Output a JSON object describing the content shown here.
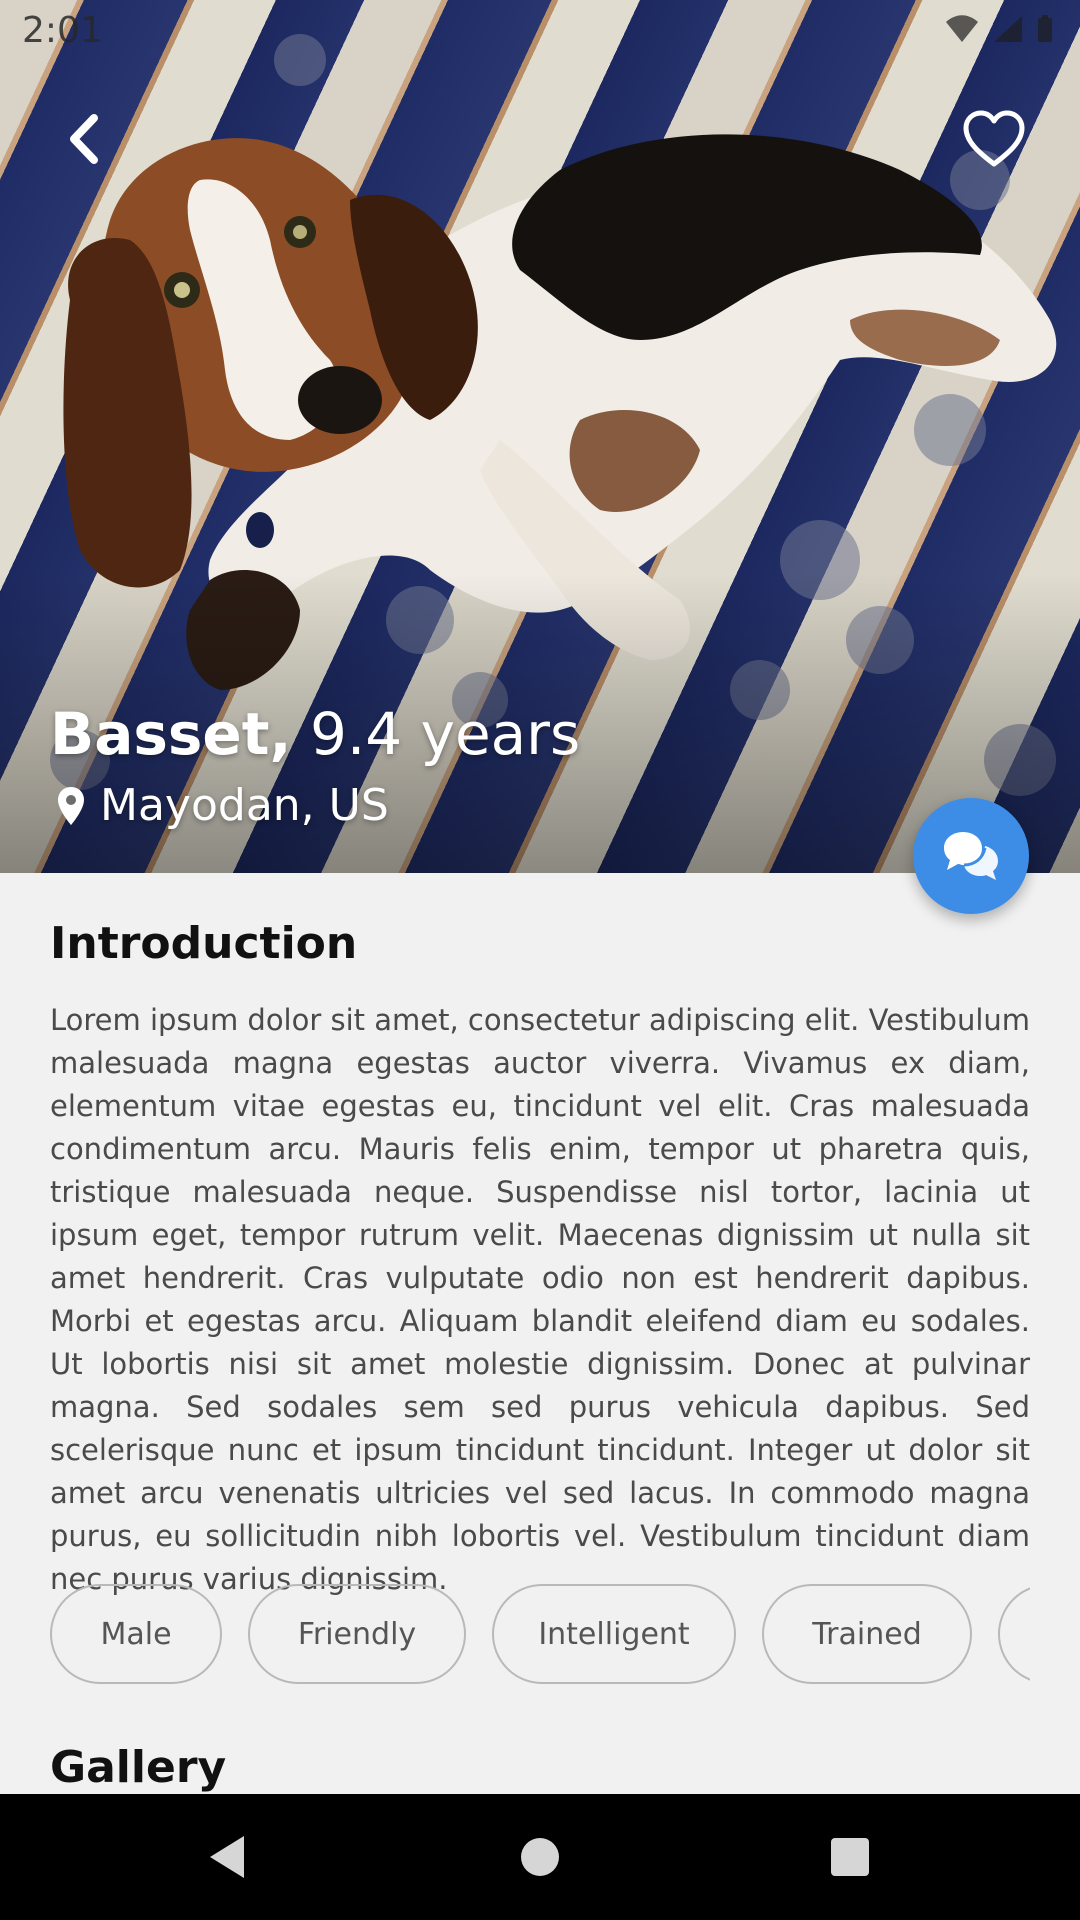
{
  "status_bar": {
    "time": "2:01"
  },
  "pet": {
    "name": "Basset,",
    "age": "9.4 years",
    "location": "Mayodan, US"
  },
  "introduction": {
    "title": "Introduction",
    "text": "Lorem ipsum dolor sit amet, consectetur adipiscing elit. Vestibulum malesuada magna egestas auctor viverra. Vivamus ex diam, elementum vitae egestas eu, tincidunt vel elit. Cras malesuada condimentum arcu. Mauris felis enim, tempor ut pharetra quis, tristique malesuada neque. Suspendisse nisl tortor, lacinia ut ipsum eget, tempor rutrum velit. Maecenas dignissim ut nulla sit amet hendrerit. Cras vulputate odio non est hendrerit dapibus. Morbi et egestas arcu. Aliquam blandit eleifend diam eu sodales. Ut lobortis nisi sit amet molestie dignissim. Donec at pulvinar magna. Sed sodales sem sed purus vehicula dapibus. Sed scelerisque nunc et ipsum tincidunt tincidunt. Integer ut dolor sit amet arcu venenatis ultricies vel sed lacus. In commodo magna purus, eu sollicitudin nibh lobortis vel. Vestibulum tincidunt diam nec purus varius dignissim."
  },
  "traits": [
    "Male",
    "Friendly",
    "Intelligent",
    "Trained",
    ""
  ],
  "gallery": {
    "title": "Gallery"
  },
  "colors": {
    "accent": "#3d8de6",
    "background": "#f1f1f2",
    "navbar": "#000000"
  },
  "icons": {
    "back": "chevron-left-icon",
    "favorite": "heart-outline-icon",
    "location": "location-pin-icon",
    "chat": "chat-bubbles-icon"
  }
}
